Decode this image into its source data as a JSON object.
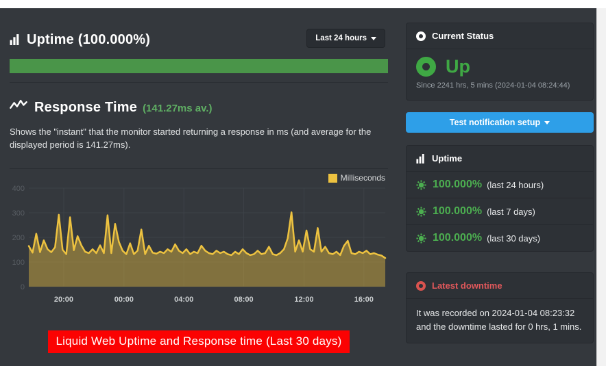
{
  "uptime_header": {
    "title": "Uptime (100.000%)",
    "range_label": "Last 24 hours"
  },
  "response_time": {
    "title": "Response Time",
    "average_label": "(141.27ms av.)",
    "description": "Shows the \"instant\" that the monitor started returning a response in ms (and average for the displayed period is 141.27ms).",
    "legend_label": "Milliseconds"
  },
  "banner": {
    "text": "Liquid Web Uptime and Response time (Last 30 days)"
  },
  "current_status": {
    "header": "Current Status",
    "status": "Up",
    "since": "Since 2241 hrs, 5 mins (2024-01-04 08:24:44)"
  },
  "notification_button": {
    "label": "Test notification setup"
  },
  "uptime_stats": {
    "header": "Uptime",
    "rows": [
      {
        "value": "100.000%",
        "period": "(last 24 hours)"
      },
      {
        "value": "100.000%",
        "period": "(last 7 days)"
      },
      {
        "value": "100.000%",
        "period": "(last 30 days)"
      }
    ]
  },
  "latest_downtime": {
    "header": "Latest downtime",
    "text": "It was recorded on 2024-01-04 08:23:32 and the downtime lasted for 0 hrs, 1 mins."
  },
  "colors": {
    "background": "#34383d",
    "panel": "#2d3136",
    "green_status": "#3fa844",
    "green_bar": "#4a9549",
    "accent_blue": "#2e9fe8",
    "chart_yellow": "#edc240",
    "banner_red": "#fb0202",
    "downtime_red": "#d9534f"
  },
  "chart_data": {
    "type": "area",
    "title": "Response Time",
    "ylabel": "Milliseconds",
    "legend": [
      "Milliseconds"
    ],
    "legend_position": "top-right",
    "grid": true,
    "ylim": [
      0,
      400
    ],
    "y_ticks": [
      0,
      100,
      200,
      300,
      400
    ],
    "x_tick_labels": [
      "20:00",
      "00:00",
      "04:00",
      "08:00",
      "12:00",
      "16:00"
    ],
    "x_tick_fractions": [
      0.098,
      0.267,
      0.435,
      0.603,
      0.772,
      0.94
    ],
    "average_ms": 141.27,
    "unit": "ms",
    "values": [
      165,
      138,
      215,
      140,
      188,
      152,
      140,
      160,
      292,
      150,
      132,
      282,
      148,
      205,
      168,
      142,
      136,
      152,
      136,
      168,
      136,
      290,
      136,
      255,
      182,
      146,
      132,
      176,
      132,
      146,
      232,
      132,
      166,
      138,
      134,
      142,
      136,
      152,
      142,
      172,
      146,
      136,
      152,
      132,
      142,
      136,
      166,
      146,
      136,
      132,
      146,
      136,
      142,
      132,
      128,
      142,
      132,
      152,
      136,
      128,
      132,
      146,
      132,
      136,
      162,
      132,
      128,
      136,
      152,
      196,
      302,
      142,
      188,
      142,
      228,
      152,
      142,
      238,
      142,
      162,
      136,
      132,
      142,
      128,
      166,
      186,
      136,
      132,
      142,
      136,
      146,
      132,
      136,
      130,
      126,
      116
    ]
  }
}
